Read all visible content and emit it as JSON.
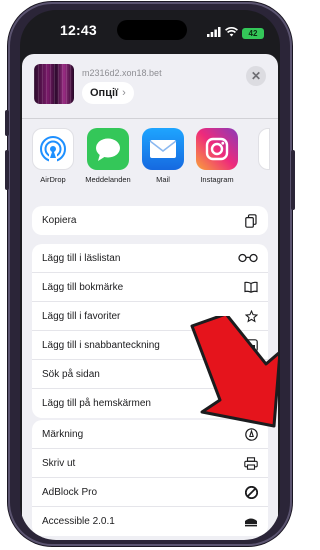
{
  "status_bar": {
    "time": "12:43",
    "battery": "42"
  },
  "share_header": {
    "site": "m2316d2.xon18.bet",
    "options_label": "Опції",
    "options_chevron": "›",
    "close_symbol": "✕"
  },
  "apps": [
    {
      "label": "AirDrop",
      "icon": "airdrop-icon",
      "color": "#1e90ff"
    },
    {
      "label": "Meddelanden",
      "icon": "messages-icon",
      "color": "#34c759"
    },
    {
      "label": "Mail",
      "icon": "mail-icon",
      "color": "#1f8bf0"
    },
    {
      "label": "Instagram",
      "icon": "instagram-icon",
      "color": "#e1306c"
    }
  ],
  "copy_group": [
    {
      "label": "Kopiera",
      "icon": "copy-icon"
    }
  ],
  "actions_group": [
    {
      "label": "Lägg till i läslistan",
      "icon": "glasses-icon"
    },
    {
      "label": "Lägg till bokmärke",
      "icon": "book-icon"
    },
    {
      "label": "Lägg till i favoriter",
      "icon": "star-icon"
    },
    {
      "label": "Lägg till i snabbanteckning",
      "icon": "quick-note-icon"
    },
    {
      "label": "Sök på sidan",
      "icon": "find-on-page-icon"
    },
    {
      "label": "Lägg till på hemskärmen",
      "icon": "add-square-icon"
    }
  ],
  "extensions_group": [
    {
      "label": "Märkning",
      "icon": "markup-icon"
    },
    {
      "label": "Skriv ut",
      "icon": "printer-icon"
    },
    {
      "label": "AdBlock Pro",
      "icon": "adblock-icon"
    },
    {
      "label": "Accessible 2.0.1",
      "icon": "accessible-icon"
    }
  ],
  "accent_colors": {
    "arrow": "#e5141c",
    "sheet_bg": "#efeff4",
    "frame": "#2b2538"
  }
}
